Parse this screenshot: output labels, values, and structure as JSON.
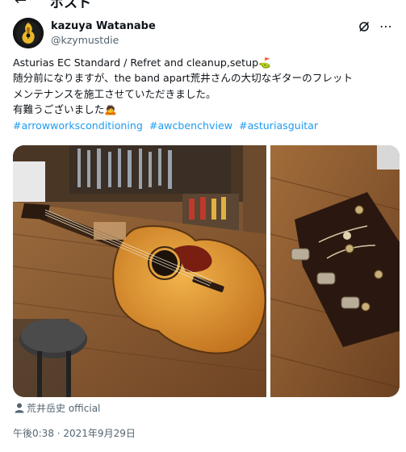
{
  "topbar": {
    "back_icon": "back-arrow-icon",
    "title": "ポスト"
  },
  "author": {
    "display_name": "kazuya Watanabe",
    "handle": "@kzymustdie"
  },
  "header_icons": [
    "grok-icon",
    "more-options-icon"
  ],
  "tweet": {
    "line1": "Asturias EC Standard / Refret and cleanup,setup",
    "emoji1": "⛳",
    "line2": "随分前になりますが、the band apart荒井さんの大切なギターのフレット",
    "line3": "メンテナンスを施工させていただきました。",
    "line4": "有難うございました",
    "emoji2": "🙇",
    "hashtags": [
      "#arrowworksconditioning",
      "#awcbenchview",
      "#asturiasguitar"
    ]
  },
  "media": {
    "photo1": "acoustic guitar on workbench",
    "photo2": "guitar headstock with tuners"
  },
  "tagged_user": "荒井岳史 official",
  "timestamp": "午後0:38 · 2021年9月29日",
  "colors": {
    "link": "#1d9bf0",
    "secondary": "#536471",
    "text": "#0f1419"
  }
}
